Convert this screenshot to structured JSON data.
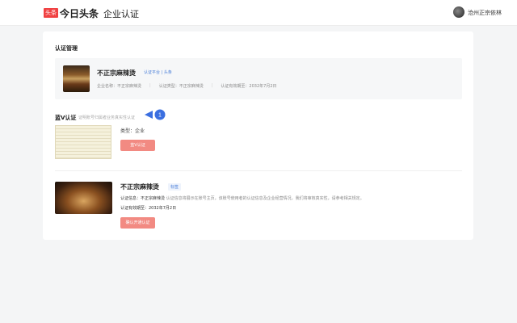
{
  "header": {
    "logo_text": "头条",
    "brand": "今日头条",
    "page_title": "企业认证",
    "user_name": "沧州正宗依林"
  },
  "section": {
    "title": "认证管理"
  },
  "account": {
    "name": "不正宗麻辣烫",
    "tag": "认证平台 | 头条",
    "company_label": "企业名称：不正宗麻辣烫",
    "type_label": "认证类型：不正宗麻辣烫",
    "expire_label": "认证有效期至：2032年7月2日"
  },
  "blue_v": {
    "label": "蓝V认证",
    "hint": "证明账号归属者业务真实性认证",
    "callout_number": "1",
    "type_line": "类型：企业",
    "apply_button": "蓝V认证"
  },
  "pro": {
    "name": "不正宗麻辣烫",
    "tag": "标签",
    "info_prefix": "认证信息：",
    "info_name": "不正宗麻辣烫",
    "info_desc": "认证信息将展示在账号主页，该账号使用者的认证信息及企业经营情况，我们将审核真实性，请参考相关规定。",
    "valid_until": "认证有效期至：2032年7月2日",
    "confirm_button": "确认开通认证"
  },
  "colors": {
    "accent_red": "#f04142",
    "button_red": "#f28a82",
    "callout_blue": "#3b6fe0",
    "tag_blue": "#4a7fd8"
  }
}
